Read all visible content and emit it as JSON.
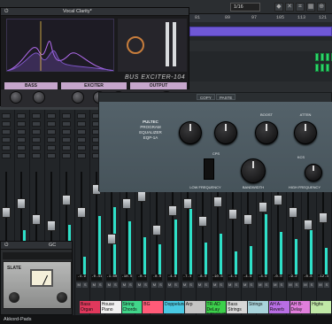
{
  "toolbar": {
    "position_display": "1/16"
  },
  "arrange": {
    "ruler_marks": [
      "81",
      "89",
      "97",
      "105",
      "113",
      "121"
    ]
  },
  "exciter": {
    "preset": "Vocal Clarity*",
    "product_name": "BUS EXCITER-104",
    "bands": [
      "BASS",
      "EXCITER",
      "OUTPUT"
    ],
    "knob_labels": [
      "Freq",
      "Mix",
      "Harmonic",
      "Freq",
      "Mix",
      "Level"
    ]
  },
  "eq": {
    "header_buttons": [
      "COPY",
      "PASTE"
    ],
    "brand_line1": "PULTEC",
    "brand_line2": "PROGRAM EQUALIZER",
    "brand_line3": "EQP-1A",
    "label_cps": "CPS",
    "label_kcs": "KCS",
    "label_low_frequency": "LOW FREQUENCY",
    "label_bandwidth": "BANDWIDTH",
    "label_high_frequency": "HIGH FREQUENCY",
    "label_boost": "BOOST",
    "label_atten": "ATTEN",
    "label_attn": "ATTN"
  },
  "compressor": {
    "preset": "GC",
    "brand": "SLATE"
  },
  "mixer": {
    "value_readouts": [
      "-6.6",
      "-6.6",
      "-6.4",
      "-14",
      "-4.4",
      "-4.9",
      "-0.41",
      "-1.60",
      "-10.6",
      "-0.1",
      "-0.6",
      "-4.8",
      "-7.4",
      "-8.0",
      "-10.6",
      "-4.1",
      "-4.9",
      "-4.9",
      "-0.0",
      "-9.2",
      "-0.8",
      "-12.4"
    ],
    "channel_names": [
      "Bass Organ",
      "House Piano",
      "String Chords",
      "BG",
      "Doppelung",
      "Arp",
      "TR-AD DeLay ETERNITY",
      "Bass Strings",
      "Strings",
      "AH A-Reverb",
      "AH B-Delay",
      "Highs"
    ],
    "channel_colors": [
      "#e0385c",
      "#f0f0f0",
      "#41d68a",
      "#ff5b78",
      "#49c9e3",
      "#c4c4c4",
      "#3cd04b",
      "#d7d7d7",
      "#a8d4dc",
      "#b86ee4",
      "#e07edc",
      "#c0e8a6"
    ]
  },
  "bottom_bar": {
    "selected_track": "Akkord-Pads"
  }
}
